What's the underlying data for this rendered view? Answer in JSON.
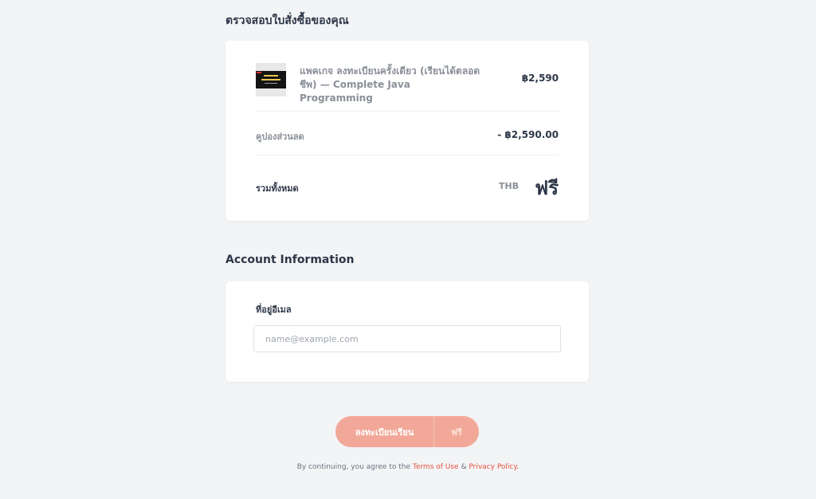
{
  "order": {
    "title": "ตรวจสอบใบสั่งซื้อของคุณ",
    "product": {
      "name": "แพคเกจ ลงทะเบียนครั้งเดียว (เรียนได้ตลอดชีพ) — Complete Java Programming",
      "price": "฿2,590"
    },
    "coupon": {
      "label": "คูปองส่วนลด",
      "value": "- ฿2,590.00"
    },
    "total": {
      "label": "รวมทั้งหมด",
      "currency": "THB",
      "value": "ฟรี"
    }
  },
  "account": {
    "title": "Account Information",
    "email_label": "ที่อยู่อีเมล",
    "email_placeholder": "name@example.com",
    "email_value": ""
  },
  "enroll": {
    "label": "ลงทะเบียนเรียน",
    "price": "ฟรี"
  },
  "terms": {
    "prefix": "By continuing, you agree to the",
    "terms_link": "Terms of Use",
    "conjunction": "&",
    "privacy_link": "Privacy Policy",
    "suffix": "."
  },
  "colors": {
    "background": "#f3f4f6",
    "button": "#f2a899",
    "link": "#e5533d"
  }
}
